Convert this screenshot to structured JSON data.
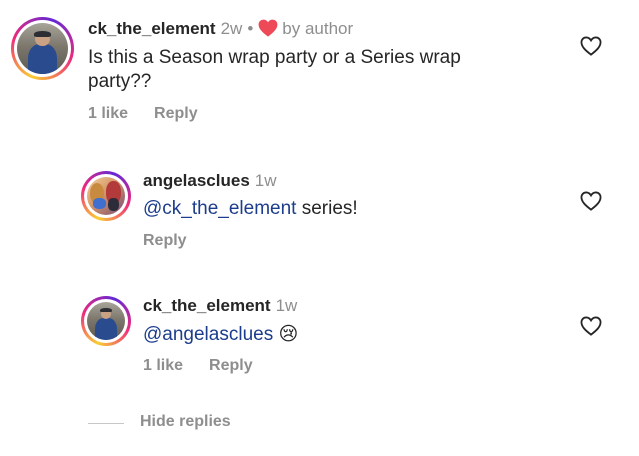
{
  "comments": [
    {
      "username": "ck_the_element",
      "time": "2w",
      "separator": "•",
      "author_badge": "by author",
      "text": "Is this a Season wrap party or a Series wrap party??",
      "likes": "1 like",
      "reply": "Reply",
      "avatar_icon": "profile-photo"
    },
    {
      "username": "angelasclues",
      "time": "1w",
      "mention": "@ck_the_element",
      "text": " series!",
      "reply": "Reply",
      "avatar_icon": "profile-photo"
    },
    {
      "username": "ck_the_element",
      "time": "1w",
      "mention": "@angelasclues",
      "emoji": "😢",
      "likes": "1 like",
      "reply": "Reply",
      "avatar_icon": "profile-photo"
    }
  ],
  "hide_replies": "Hide replies",
  "colors": {
    "author_heart": "#ed4956",
    "mention": "#1c3d8c",
    "muted": "#8e8e8e"
  }
}
